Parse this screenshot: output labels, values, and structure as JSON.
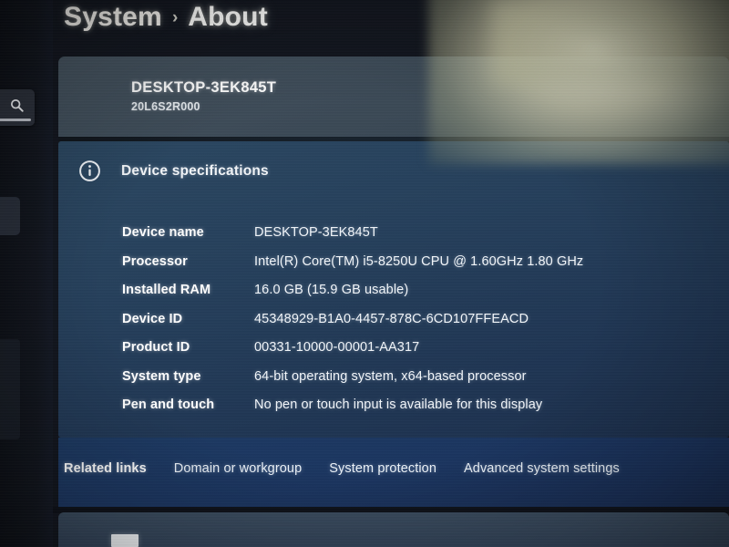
{
  "breadcrumb": {
    "root": "System",
    "separator": "›",
    "current": "About"
  },
  "device_card": {
    "name": "DESKTOP-3EK845T",
    "model": "20L6S2R000"
  },
  "specs_section": {
    "icon": "info-circle-icon",
    "title": "Device specifications",
    "rows": [
      {
        "label": "Device name",
        "value": "DESKTOP-3EK845T"
      },
      {
        "label": "Processor",
        "value": "Intel(R) Core(TM) i5-8250U CPU @ 1.60GHz   1.80 GHz"
      },
      {
        "label": "Installed RAM",
        "value": "16.0 GB (15.9 GB usable)"
      },
      {
        "label": "Device ID",
        "value": "45348929-B1A0-4457-878C-6CD107FFEACD"
      },
      {
        "label": "Product ID",
        "value": "00331-10000-00001-AA317"
      },
      {
        "label": "System type",
        "value": "64-bit operating system, x64-based processor"
      },
      {
        "label": "Pen and touch",
        "value": "No pen or touch input is available for this display"
      }
    ]
  },
  "related_links": {
    "title": "Related links",
    "links": [
      "Domain or workgroup",
      "System protection",
      "Advanced system settings"
    ]
  },
  "left_rail": {
    "search_icon": "search-icon"
  },
  "colors": {
    "page_background": "#12161f",
    "device_card": "#3c4a57",
    "specs_card": "#26405c",
    "related_links_card": "#1b3560",
    "text_primary": "#ffffff",
    "text_secondary": "#e6ebef"
  }
}
